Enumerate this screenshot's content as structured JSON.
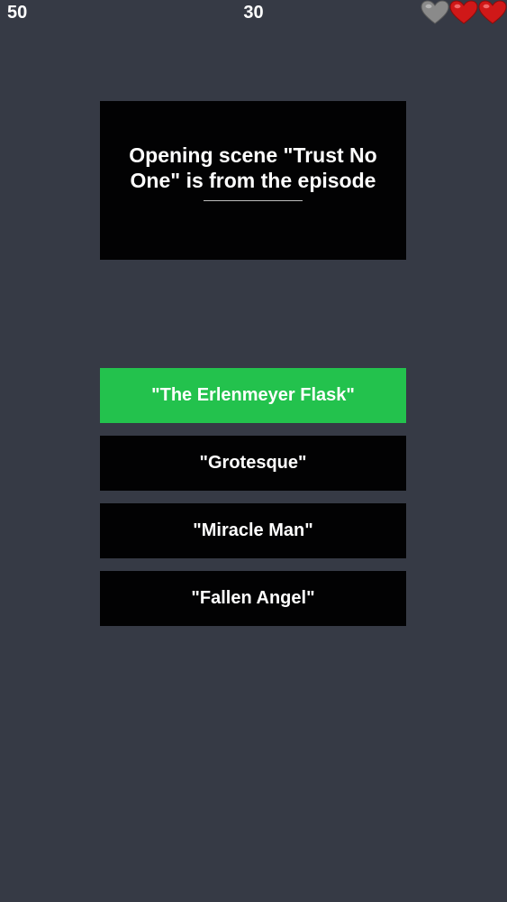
{
  "hud": {
    "score": "50",
    "timer": "30",
    "lives": [
      {
        "state": "lost",
        "color": "#8a8a8a"
      },
      {
        "state": "full",
        "color": "#d01818"
      },
      {
        "state": "full",
        "color": "#d01818"
      }
    ]
  },
  "question": {
    "text": "Opening scene  \"Trust No One\" is from the episode"
  },
  "answers": [
    {
      "label": "\"The Erlenmeyer Flask\"",
      "state": "correct",
      "color": "#23c24d"
    },
    {
      "label": "\"Grotesque\"",
      "state": "default",
      "color": "#020203"
    },
    {
      "label": "\"Miracle Man\"",
      "state": "default",
      "color": "#020203"
    },
    {
      "label": "\"Fallen Angel\"",
      "state": "default",
      "color": "#020203"
    }
  ],
  "theme": {
    "background": "#363a45",
    "panel": "#020203",
    "correct": "#23c24d",
    "text": "#ffffff"
  }
}
